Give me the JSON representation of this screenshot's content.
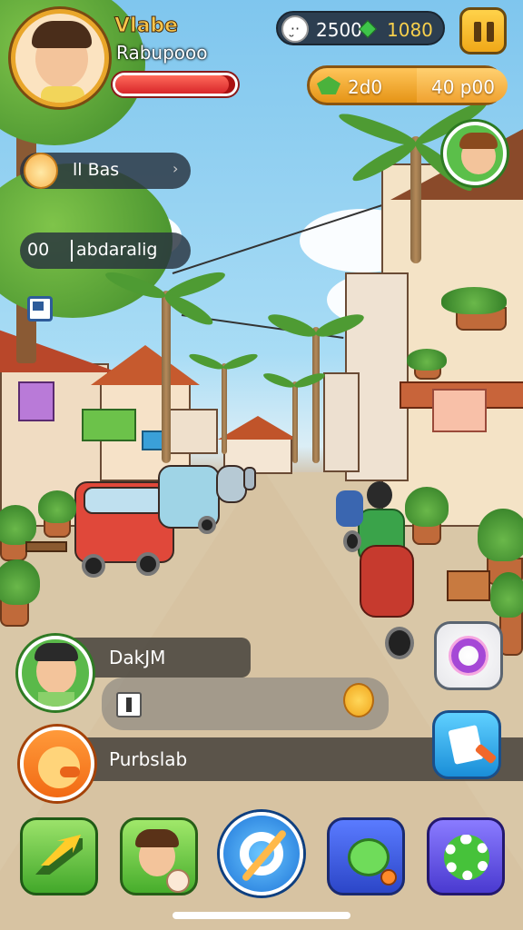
{
  "player": {
    "name": "Vlabe",
    "subtitle": "Rabupooo",
    "health_fraction": 0.95
  },
  "resources": {
    "ghost_value": "2500",
    "gem_value": "1080",
    "gold_value": "2d0",
    "gold_secondary": "40 p00"
  },
  "quests": [
    {
      "label": "ll Bas",
      "arrow": "›"
    },
    {
      "number": "00",
      "label": "abdaralig"
    }
  ],
  "dialogs": [
    {
      "speaker": "DakJM"
    },
    {
      "speaker": "Purbslab"
    }
  ],
  "icons": {
    "pause": "pause-icon",
    "health": "health-bar",
    "ghost": "ghost-icon",
    "gem": "gem-icon",
    "coin": "coin-icon",
    "npc": "npc-portrait",
    "chick": "chick-icon",
    "flag": "flag-icon",
    "magic": "magic-circle-icon",
    "note": "note-icon",
    "nav": [
      "growth-icon",
      "family-icon",
      "compass-icon",
      "creature-icon",
      "settings-icon"
    ]
  },
  "colors": {
    "health_red": "#d8262a",
    "gold": "#f0a818",
    "sky": "#7fc6ee"
  }
}
